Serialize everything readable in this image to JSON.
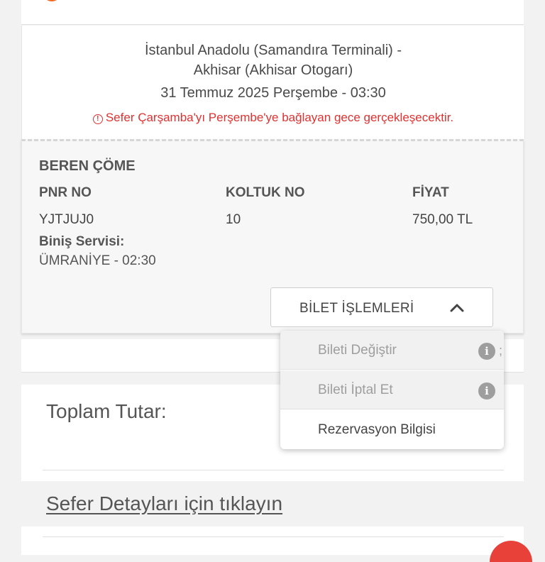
{
  "trip": {
    "route_line1": "İstanbul Anadolu (Samandıra Terminali) -",
    "route_line2": "Akhisar (Akhisar Otogarı)",
    "date": "31 Temmuz 2025 Perşembe - 03:30",
    "notice": "Sefer Çarşamba'yı Perşembe'ye bağlayan gece gerçekleşecektir.",
    "notice_icon": "info-circle-icon"
  },
  "passenger": {
    "name": "BEREN ÇÖME",
    "pnr_label": "PNR NO",
    "pnr_value": "YJTJUJ0",
    "seat_label": "KOLTUK NO",
    "seat_value": "10",
    "price_label": "FİYAT",
    "price_value": "750,00 TL",
    "boarding_label": "Biniş Servisi:",
    "boarding_value": "ÜMRANİYE - 02:30"
  },
  "ticket_ops": {
    "label": "BİLET İŞLEMLERİ",
    "icon": "chevron-up-icon",
    "items": [
      {
        "label": "Bileti Değiştir",
        "disabled": true,
        "icon": "info-icon"
      },
      {
        "label": "Bileti İptal Et",
        "disabled": true,
        "icon": "info-icon"
      },
      {
        "label": "Rezervasyon Bilgisi",
        "disabled": false
      }
    ]
  },
  "summary": {
    "total_label": "Toplam Tutar:",
    "details_link": "Sefer Detayları için tıklayın"
  },
  "colors": {
    "brand": "#f26a21",
    "alert": "#e03131",
    "disabled": "#9e9e9e"
  }
}
